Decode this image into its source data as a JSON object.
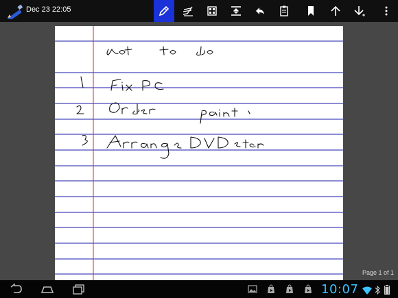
{
  "header": {
    "title": "Dec 23 22:05"
  },
  "toolbar": {
    "tools": [
      {
        "icon": "pen-icon",
        "active": true
      },
      {
        "icon": "eraser-icon",
        "active": false
      },
      {
        "icon": "grid-icon",
        "active": false
      },
      {
        "icon": "insert-space-icon",
        "active": false
      },
      {
        "icon": "undo-icon",
        "active": false
      },
      {
        "icon": "clipboard-icon",
        "active": false
      },
      {
        "icon": "bookmark-icon",
        "active": false
      },
      {
        "icon": "arrow-up-icon",
        "active": false
      },
      {
        "icon": "arrow-down-add-icon",
        "active": false
      },
      {
        "icon": "overflow-menu-icon",
        "active": false
      }
    ],
    "accent": "#1a32d8"
  },
  "page": {
    "background": "#ffffff",
    "rule_color": "#1a1aa8",
    "margin_color": "#d8262c"
  },
  "footer": {
    "page_indicator": "Page 1 of 1"
  },
  "status_bar": {
    "time": "10:07",
    "clock_color": "#3cc3ff",
    "nav_buttons": [
      "back-icon",
      "home-icon",
      "recent-apps-icon"
    ],
    "notifications": [
      "gallery-icon",
      "play-store-icon",
      "play-store-icon",
      "play-store-icon"
    ],
    "status_icons": [
      "wifi-icon",
      "bluetooth-icon",
      "battery-icon"
    ]
  }
}
